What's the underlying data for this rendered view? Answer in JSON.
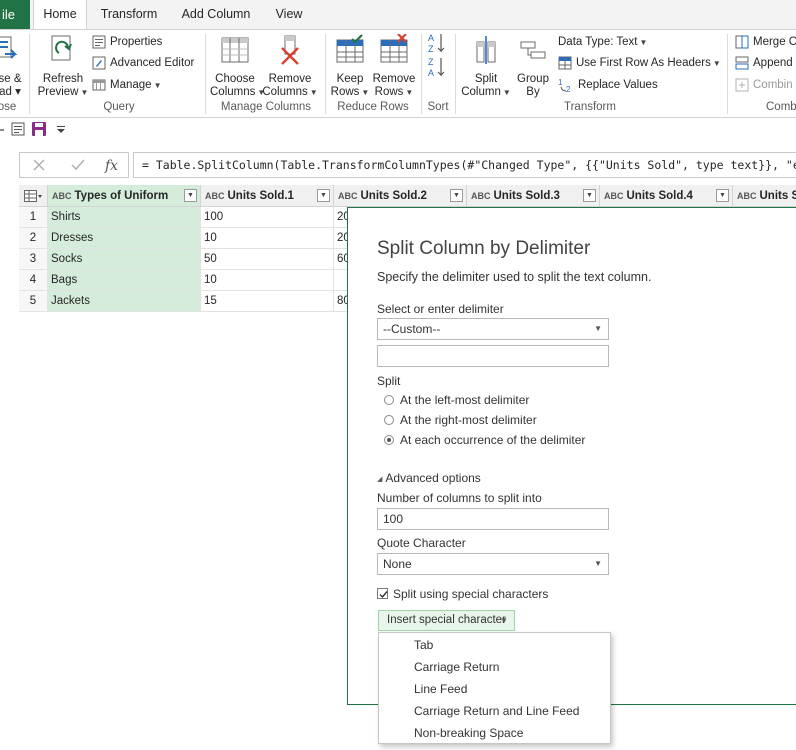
{
  "tabs": {
    "file": "ile",
    "home": "Home",
    "transform": "Transform",
    "add_column": "Add Column",
    "view": "View"
  },
  "ribbon": {
    "close": {
      "label1": "se &",
      "label2": "ad ▾",
      "group": "ose"
    },
    "query": {
      "refresh1": "Refresh",
      "refresh2": "Preview",
      "properties": "Properties",
      "advanced_editor": "Advanced Editor",
      "manage": "Manage",
      "group": "Query"
    },
    "manage_columns": {
      "choose1": "Choose",
      "choose2": "Columns",
      "remove1": "Remove",
      "remove2": "Columns",
      "group": "Manage Columns"
    },
    "reduce_rows": {
      "keep1": "Keep",
      "keep2": "Rows",
      "remove1": "Remove",
      "remove2": "Rows",
      "group": "Reduce Rows"
    },
    "sort": {
      "group": "Sort"
    },
    "transform": {
      "split1": "Split",
      "split2": "Column",
      "group1": "Group",
      "group2": "By",
      "data_type": "Data Type: Text",
      "first_row": "Use First Row As Headers",
      "replace": "Replace Values",
      "group": "Transform"
    },
    "combine": {
      "merge": "Merge C",
      "append": "Append",
      "combine": "Combin",
      "group": "Comb"
    }
  },
  "formula": "= Table.SplitColumn(Table.TransformColumnTypes(#\"Changed Type\", {{\"Units Sold\", type text}}, \"en-AU\"), \"Units Sold\"",
  "grid": {
    "type_glyph": "ABC",
    "headers": [
      "Types of Uniform",
      "Units Sold.1",
      "Units Sold.2",
      "Units Sold.3",
      "Units Sold.4",
      "Units So"
    ],
    "rows": [
      {
        "n": "1",
        "type": "Shirts",
        "u1": "100",
        "u2": "20"
      },
      {
        "n": "2",
        "type": "Dresses",
        "u1": "10",
        "u2": "20"
      },
      {
        "n": "3",
        "type": "Socks",
        "u1": "50",
        "u2": "60"
      },
      {
        "n": "4",
        "type": "Bags",
        "u1": "10",
        "u2": ""
      },
      {
        "n": "5",
        "type": "Jackets",
        "u1": "15",
        "u2": "80"
      }
    ]
  },
  "dialog": {
    "title": "Split Column by Delimiter",
    "subtitle": "Specify the delimiter used to split the text column.",
    "delimiter_label": "Select or enter delimiter",
    "delimiter_value": "--Custom--",
    "custom_value": "",
    "split_label": "Split",
    "split_options": [
      "At the left-most delimiter",
      "At the right-most delimiter",
      "At each occurrence of the delimiter"
    ],
    "split_selected": 2,
    "advanced": "Advanced options",
    "num_columns_label": "Number of columns to split into",
    "num_columns_value": "100",
    "quote_label": "Quote Character",
    "quote_value": "None",
    "special_chars_label": "Split using special characters",
    "special_chars_checked": true,
    "insert_label": "Insert special character",
    "menu_items": [
      "Tab",
      "Carriage Return",
      "Line Feed",
      "Carriage Return and Line Feed",
      "Non-breaking Space"
    ]
  },
  "colors": {
    "accent": "#217346",
    "selected_column": "#d5ecdb",
    "insert_button": "#e8f5ea"
  }
}
